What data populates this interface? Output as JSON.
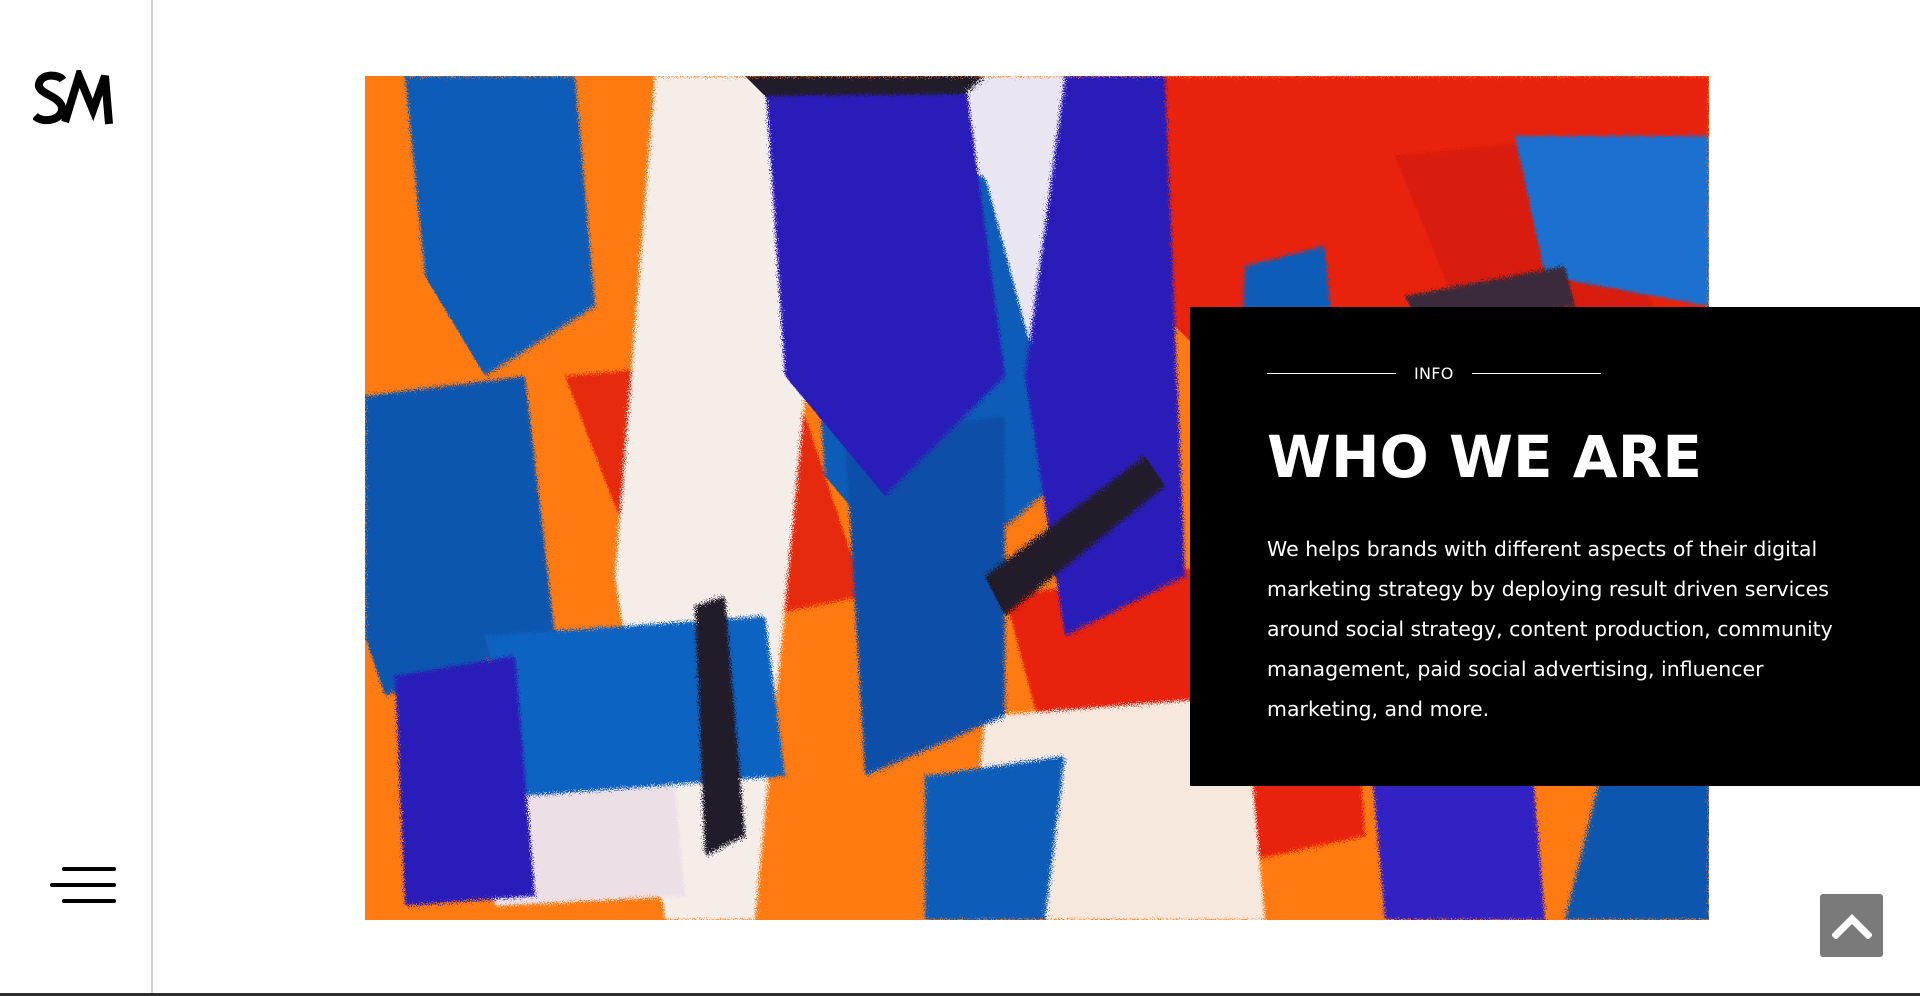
{
  "brand": {
    "logo_text": "SM",
    "logo_color": "#000000"
  },
  "nav": {
    "menu_icon": "hamburger-menu-icon"
  },
  "hero": {
    "image_subject": "abstract-painting",
    "colors": {
      "orange": "#ff7a10",
      "red": "#e8220e",
      "blue": "#0a5bb8",
      "indigo": "#2a1fb8",
      "white": "#f4ede8",
      "dark": "#241a2a"
    }
  },
  "info": {
    "eyebrow": "INFO",
    "title": "WHO WE ARE",
    "body": "We helps brands with different aspects of their digital marketing strategy by deploying result driven services around social strategy, content production, community management, paid social advertising, influencer marketing, and more.",
    "background": "#000000",
    "text_color": "#ffffff"
  },
  "back_to_top": {
    "icon": "chevron-up-icon",
    "background": "#7a7a7a"
  }
}
